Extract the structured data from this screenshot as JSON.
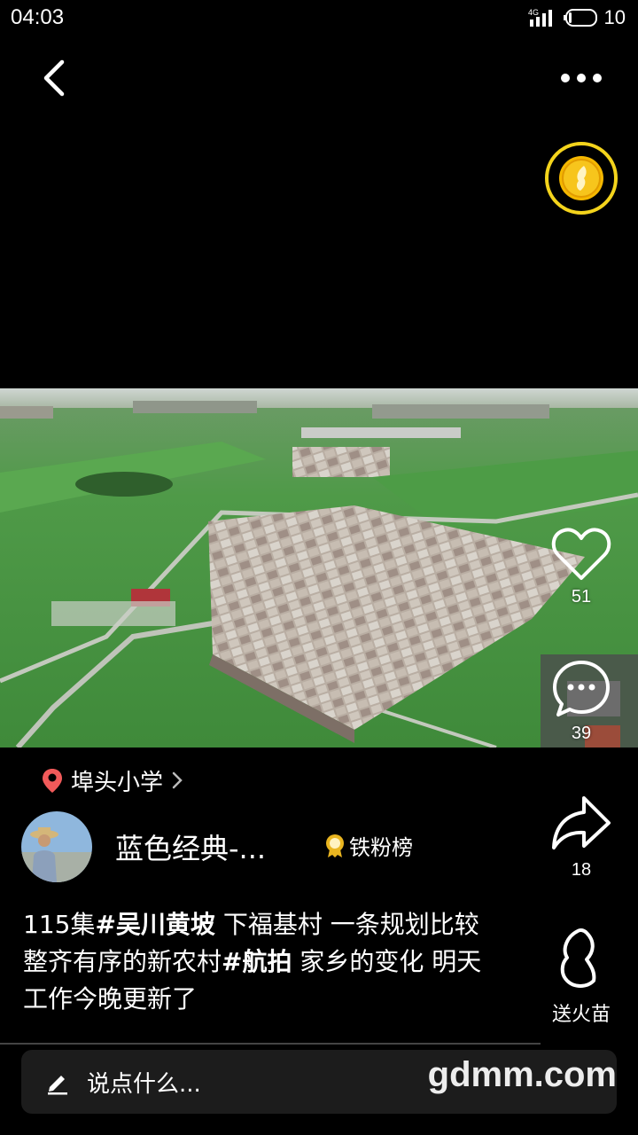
{
  "status_bar": {
    "time": "04:03",
    "network": "4G",
    "battery": "10"
  },
  "location": {
    "name": "埠头小学"
  },
  "author": {
    "name": "蓝色经典-...",
    "badge_label": "铁粉榜"
  },
  "caption": {
    "episode": "115集",
    "tag1": "#吴川黄坡",
    "text1": " 下福基村 一条规划比较整齐有序的新农村",
    "tag2": "#航拍",
    "text2": " 家乡的变化 明天工作今晚更新了"
  },
  "actions": {
    "like_count": "51",
    "comment_count": "39",
    "share_count": "18",
    "gift_label": "送火苗"
  },
  "comment_bar": {
    "placeholder": "说点什么..."
  },
  "watermark": "gdmm.com",
  "colors": {
    "coin_ring": "#f4d41c",
    "location_pin": "#f15a5a",
    "badge_gold": "#e9b520"
  }
}
